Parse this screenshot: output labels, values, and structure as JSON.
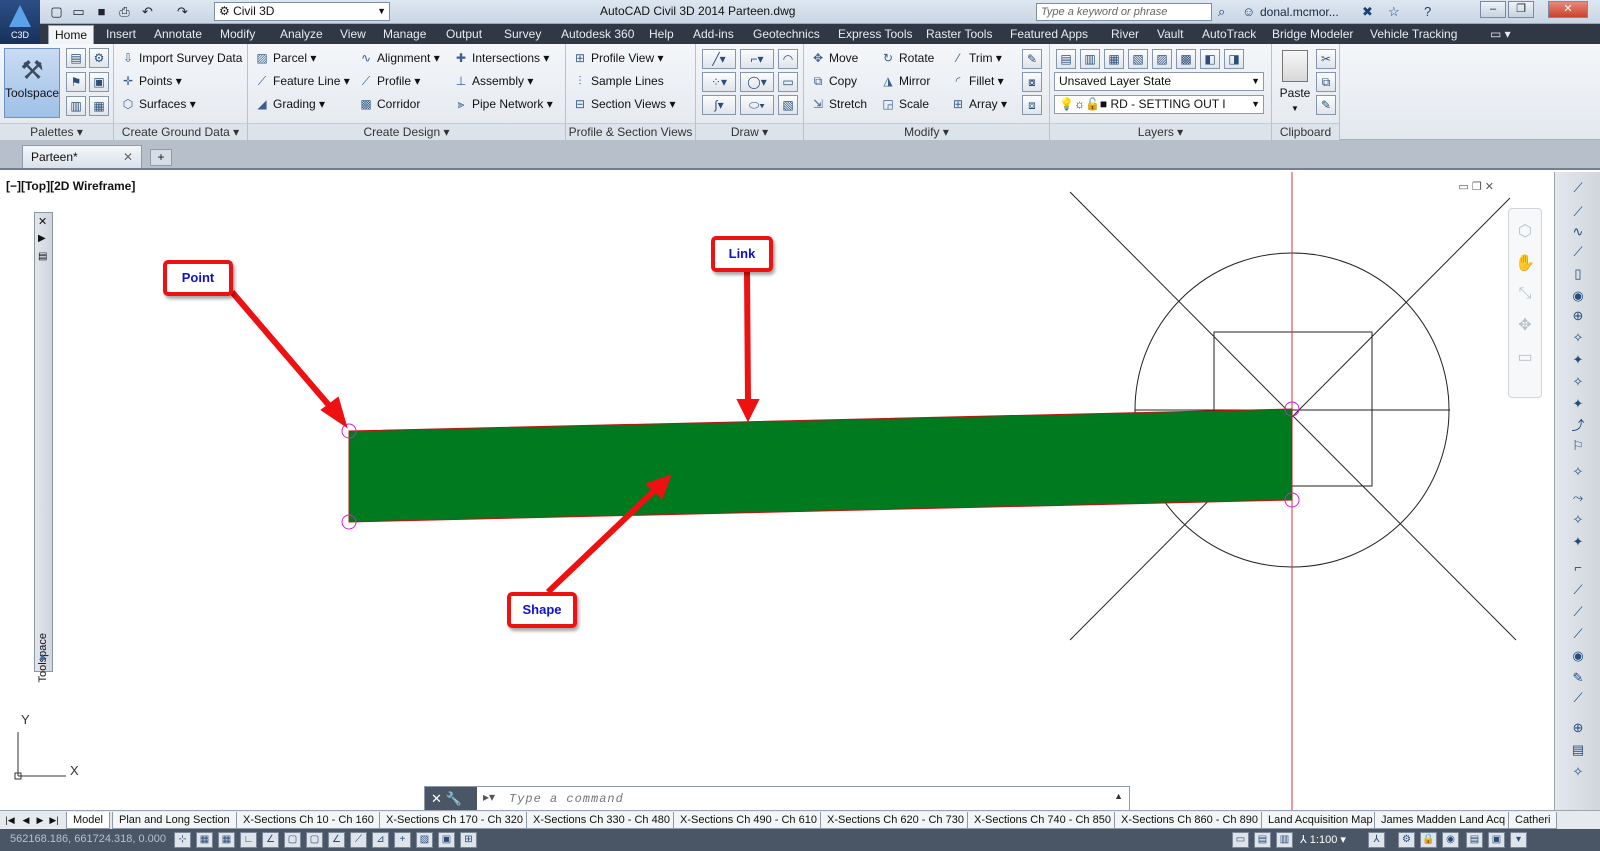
{
  "title_bar": {
    "app_logo_text": "C3D",
    "workspace": "Civil 3D",
    "window_title": "AutoCAD Civil 3D 2014    Parteen.dwg",
    "search_placeholder": "Type a keyword or phrase",
    "user": "donal.mcmor...",
    "help": "?"
  },
  "menu_tabs": [
    "Home",
    "Insert",
    "Annotate",
    "Modify",
    "Analyze",
    "View",
    "Manage",
    "Output",
    "Survey",
    "Autodesk 360",
    "Help",
    "Add-ins",
    "Geotechnics",
    "Express Tools",
    "Raster Tools",
    "Featured Apps",
    "River",
    "Vault",
    "AutoTrack",
    "Bridge Modeler",
    "Vehicle Tracking"
  ],
  "ribbon": {
    "palettes": {
      "title": "Palettes",
      "toolspace": "Toolspace"
    },
    "ground": {
      "title": "Create Ground Data",
      "import": "Import Survey Data",
      "points": "Points",
      "surfaces": "Surfaces"
    },
    "design": {
      "title": "Create Design",
      "parcel": "Parcel",
      "feature_line": "Feature Line",
      "grading": "Grading",
      "alignment": "Alignment",
      "profile": "Profile",
      "corridor": "Corridor",
      "intersections": "Intersections",
      "assembly": "Assembly",
      "pipe_network": "Pipe Network"
    },
    "profile_section": {
      "title": "Profile & Section Views",
      "profile_view": "Profile View",
      "sample_lines": "Sample Lines",
      "section_views": "Section Views"
    },
    "draw": {
      "title": "Draw"
    },
    "modify": {
      "title": "Modify",
      "move": "Move",
      "copy": "Copy",
      "stretch": "Stretch",
      "rotate": "Rotate",
      "mirror": "Mirror",
      "scale": "Scale",
      "trim": "Trim",
      "fillet": "Fillet",
      "array": "Array"
    },
    "layers": {
      "title": "Layers",
      "layer_state": "Unsaved Layer State",
      "current_layer": "RD - SETTING OUT I"
    },
    "clipboard": {
      "title": "Clipboard",
      "paste": "Paste"
    }
  },
  "doc_tab": "Parteen*",
  "viewport": {
    "label": "[−][Top][2D Wireframe]",
    "toolspace_label": "Toolspace",
    "ucs_y": "Y",
    "ucs_x": "X"
  },
  "callouts": {
    "point": "Point",
    "link": "Link",
    "shape": "Shape"
  },
  "command_placeholder": "Type a command",
  "layout_tabs": [
    "Model",
    "Plan and Long Section",
    "X-Sections Ch 10 - Ch 160",
    "X-Sections Ch 170 - Ch 320",
    "X-Sections Ch 330 - Ch 480",
    "X-Sections Ch 490 - Ch 610",
    "X-Sections Ch 620 - Ch 730",
    "X-Sections Ch 740 - Ch 850",
    "X-Sections Ch 860 - Ch 890",
    "Land Acquisition Map",
    "James Madden Land Acq",
    "Catheri"
  ],
  "status": {
    "coords": "562168.186, 661724.318, 0.000",
    "scale": "1:100"
  },
  "colors": {
    "shape_fill": "#007a1e",
    "callout_border": "#e11111",
    "callout_text": "#1010d0",
    "guide_line": "#e03030",
    "marker": "#d020d0"
  }
}
